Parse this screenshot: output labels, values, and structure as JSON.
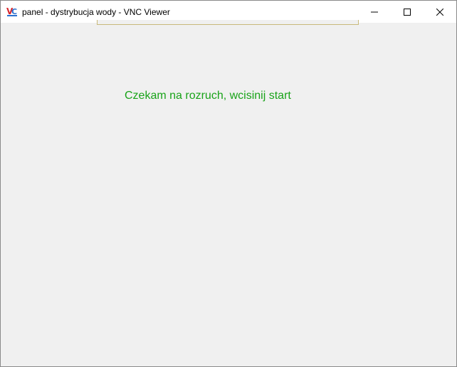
{
  "window": {
    "title": "panel - dystrybucja wody - VNC Viewer",
    "app_icon": "vnc-viewer-icon",
    "controls": {
      "minimize_icon": "minimize-icon",
      "maximize_icon": "maximize-icon",
      "close_icon": "close-icon"
    }
  },
  "remote_screen": {
    "status_message": "Czekam na rozruch, wcisinij start",
    "colors": {
      "status_text": "#19a319",
      "background": "#f0f0f0",
      "panel_border": "#c9b97a"
    }
  }
}
